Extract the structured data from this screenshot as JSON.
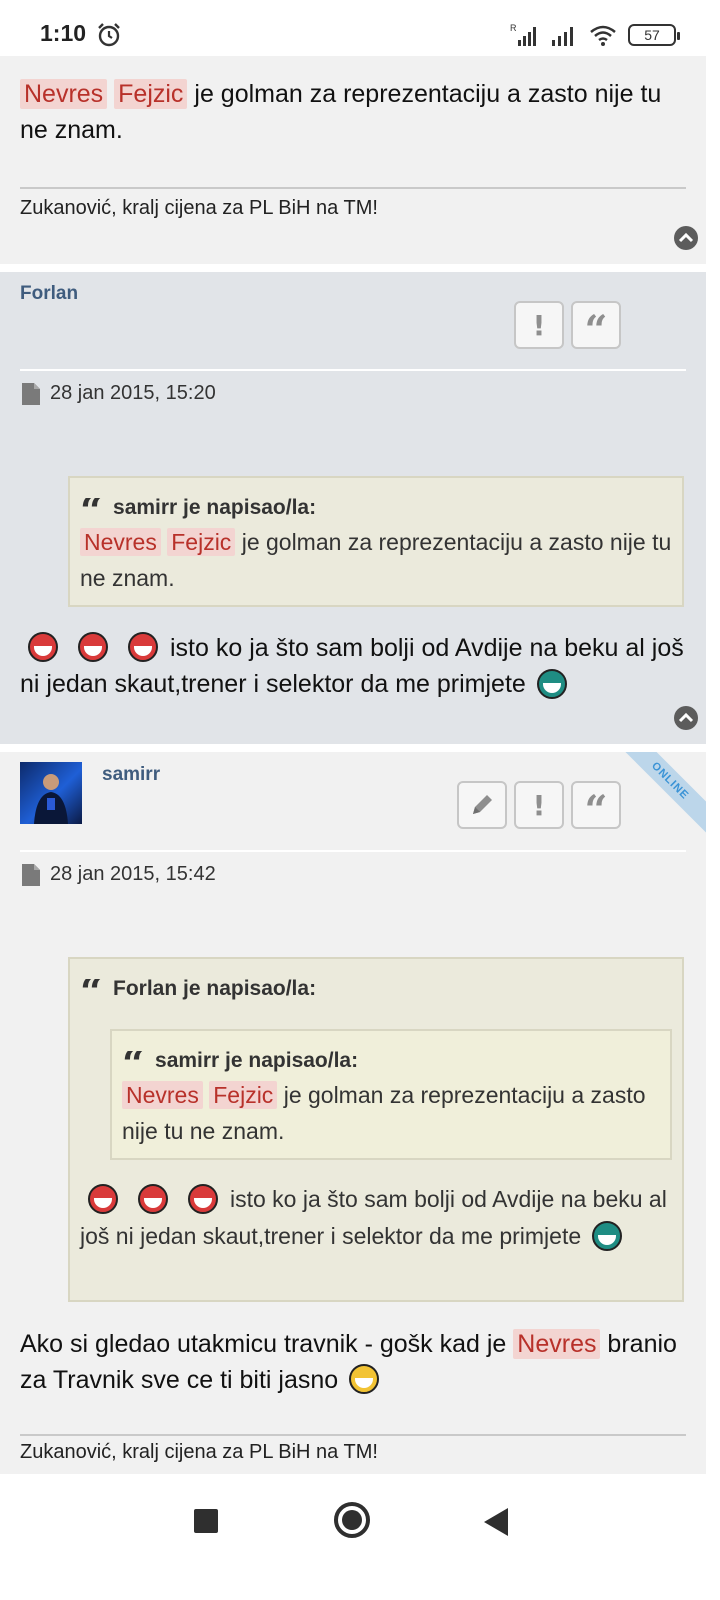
{
  "status": {
    "time": "1:10",
    "battery": "57"
  },
  "post_a": {
    "hl1": "Nevres",
    "hl2": "Fejzic",
    "text": " je golman za reprezentaciju a zasto nije tu ne znam.",
    "signature": "Zukanović, kralj cijena za PL BiH na TM!"
  },
  "post_b": {
    "author": "Forlan",
    "date": "28 jan 2015, 15:20",
    "quote_head": "samirr je napisao/la:",
    "quote_hl1": "Nevres",
    "quote_hl2": "Fejzic",
    "quote_text": " je golman za reprezentaciju a zasto nije tu ne znam.",
    "body": "isto ko ja što sam bolji od Avdije na beku al još ni jedan skaut,trener i selektor da me primjete"
  },
  "post_c": {
    "author": "samirr",
    "online": "ONLINE",
    "date": "28 jan 2015, 15:42",
    "outer_quote_head": "Forlan je napisao/la:",
    "inner_quote_head": "samirr je napisao/la:",
    "inner_hl1": "Nevres",
    "inner_hl2": "Fejzic",
    "inner_text": " je golman za reprezentaciju a zasto nije tu ne znam.",
    "outer_text": "isto ko ja što sam bolji od Avdije na beku al još ni jedan skaut,trener i selektor da me primjete",
    "body_pre": "Ako si gledao utakmicu travnik - gošk kad je ",
    "body_hl": "Nevres",
    "body_post": " branio za Travnik sve ce ti biti jasno",
    "signature": "Zukanović, kralj cijena za PL BiH na TM!"
  },
  "icons": {
    "alarm": "alarm-clock-icon",
    "report": "exclamation-icon",
    "quote": "quote-icon",
    "edit": "pencil-icon",
    "top": "chevron-up-icon"
  }
}
